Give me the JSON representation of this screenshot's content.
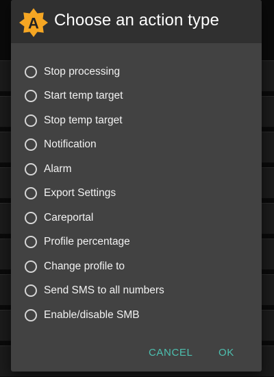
{
  "dialog": {
    "title": "Choose an action type",
    "logo_letter": "A",
    "logo_icon": "app-logo-icon",
    "options": [
      {
        "label": "Stop processing",
        "selected": false
      },
      {
        "label": "Start temp target",
        "selected": false
      },
      {
        "label": "Stop temp target",
        "selected": false
      },
      {
        "label": "Notification",
        "selected": false
      },
      {
        "label": "Alarm",
        "selected": false
      },
      {
        "label": "Export Settings",
        "selected": false
      },
      {
        "label": "Careportal",
        "selected": false
      },
      {
        "label": "Profile percentage",
        "selected": false
      },
      {
        "label": "Change profile to",
        "selected": false
      },
      {
        "label": "Send SMS to all numbers",
        "selected": false
      },
      {
        "label": "Enable/disable SMB",
        "selected": false
      }
    ],
    "cancel_label": "CANCEL",
    "ok_label": "OK"
  },
  "colors": {
    "dialog_bg": "#424242",
    "header_bg": "#303030",
    "accent": "#4dc0b0",
    "logo_orange": "#f5a623",
    "logo_letter": "#222222"
  }
}
